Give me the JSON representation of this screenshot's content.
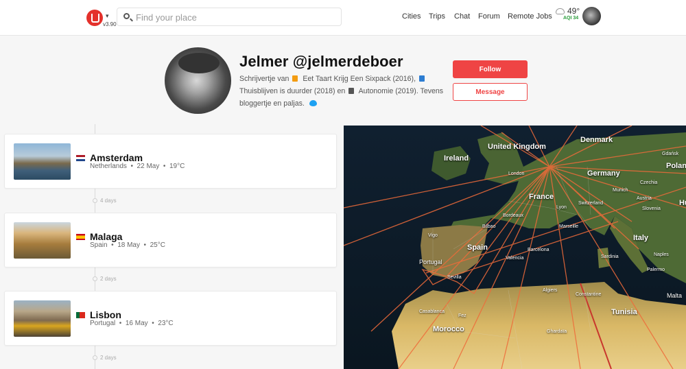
{
  "header": {
    "version": "v3.90",
    "search_placeholder": "Find your place",
    "nav": [
      {
        "label": "Cities"
      },
      {
        "label": "Trips"
      },
      {
        "label": "Chat"
      },
      {
        "label": "Forum"
      },
      {
        "label": "Remote Jobs"
      }
    ],
    "weather": {
      "temperature": "49°",
      "aqi": "AQI 34"
    }
  },
  "profile": {
    "name": "Jelmer  @jelmerdeboer",
    "bio_segments": [
      "Schrijvertje van",
      "Eet Taart Krijg Een Sixpack (2016),",
      "Thuisblijven is duurder (2018) en",
      "Autonomie (2019). Tevens bloggertje en paljas."
    ],
    "follow_label": "Follow",
    "message_label": "Message"
  },
  "trips": [
    {
      "city": "Amsterdam",
      "country": "Netherlands",
      "date": "22 May",
      "temp": "19°C",
      "flag": "nl"
    },
    {
      "city": "Malaga",
      "country": "Spain",
      "date": "18 May",
      "temp": "25°C",
      "flag": "es"
    },
    {
      "city": "Lisbon",
      "country": "Portugal",
      "date": "16 May",
      "temp": "23°C",
      "flag": "pt"
    }
  ],
  "gaps": [
    "4 days",
    "2 days",
    "2 days"
  ],
  "map_labels": [
    "Denmark",
    "United Kingdom",
    "Ireland",
    "Gdańsk",
    "Poland",
    "Germany",
    "Munich",
    "Czechia",
    "Austria",
    "Slovenia",
    "Hu",
    "France",
    "Bordeaux",
    "Lyon",
    "Marseille",
    "Switzerland",
    "Italy",
    "Naples",
    "Sardinia",
    "Palermo",
    "Malta",
    "Spain",
    "Bilbao",
    "Vigo",
    "Portugal",
    "Valencia",
    "Barcelona",
    "Sevilla",
    "Casablanca",
    "Morocco",
    "Fez",
    "Algiers",
    "Constantine",
    "Tunisia",
    "London",
    "Ghardaïa"
  ]
}
